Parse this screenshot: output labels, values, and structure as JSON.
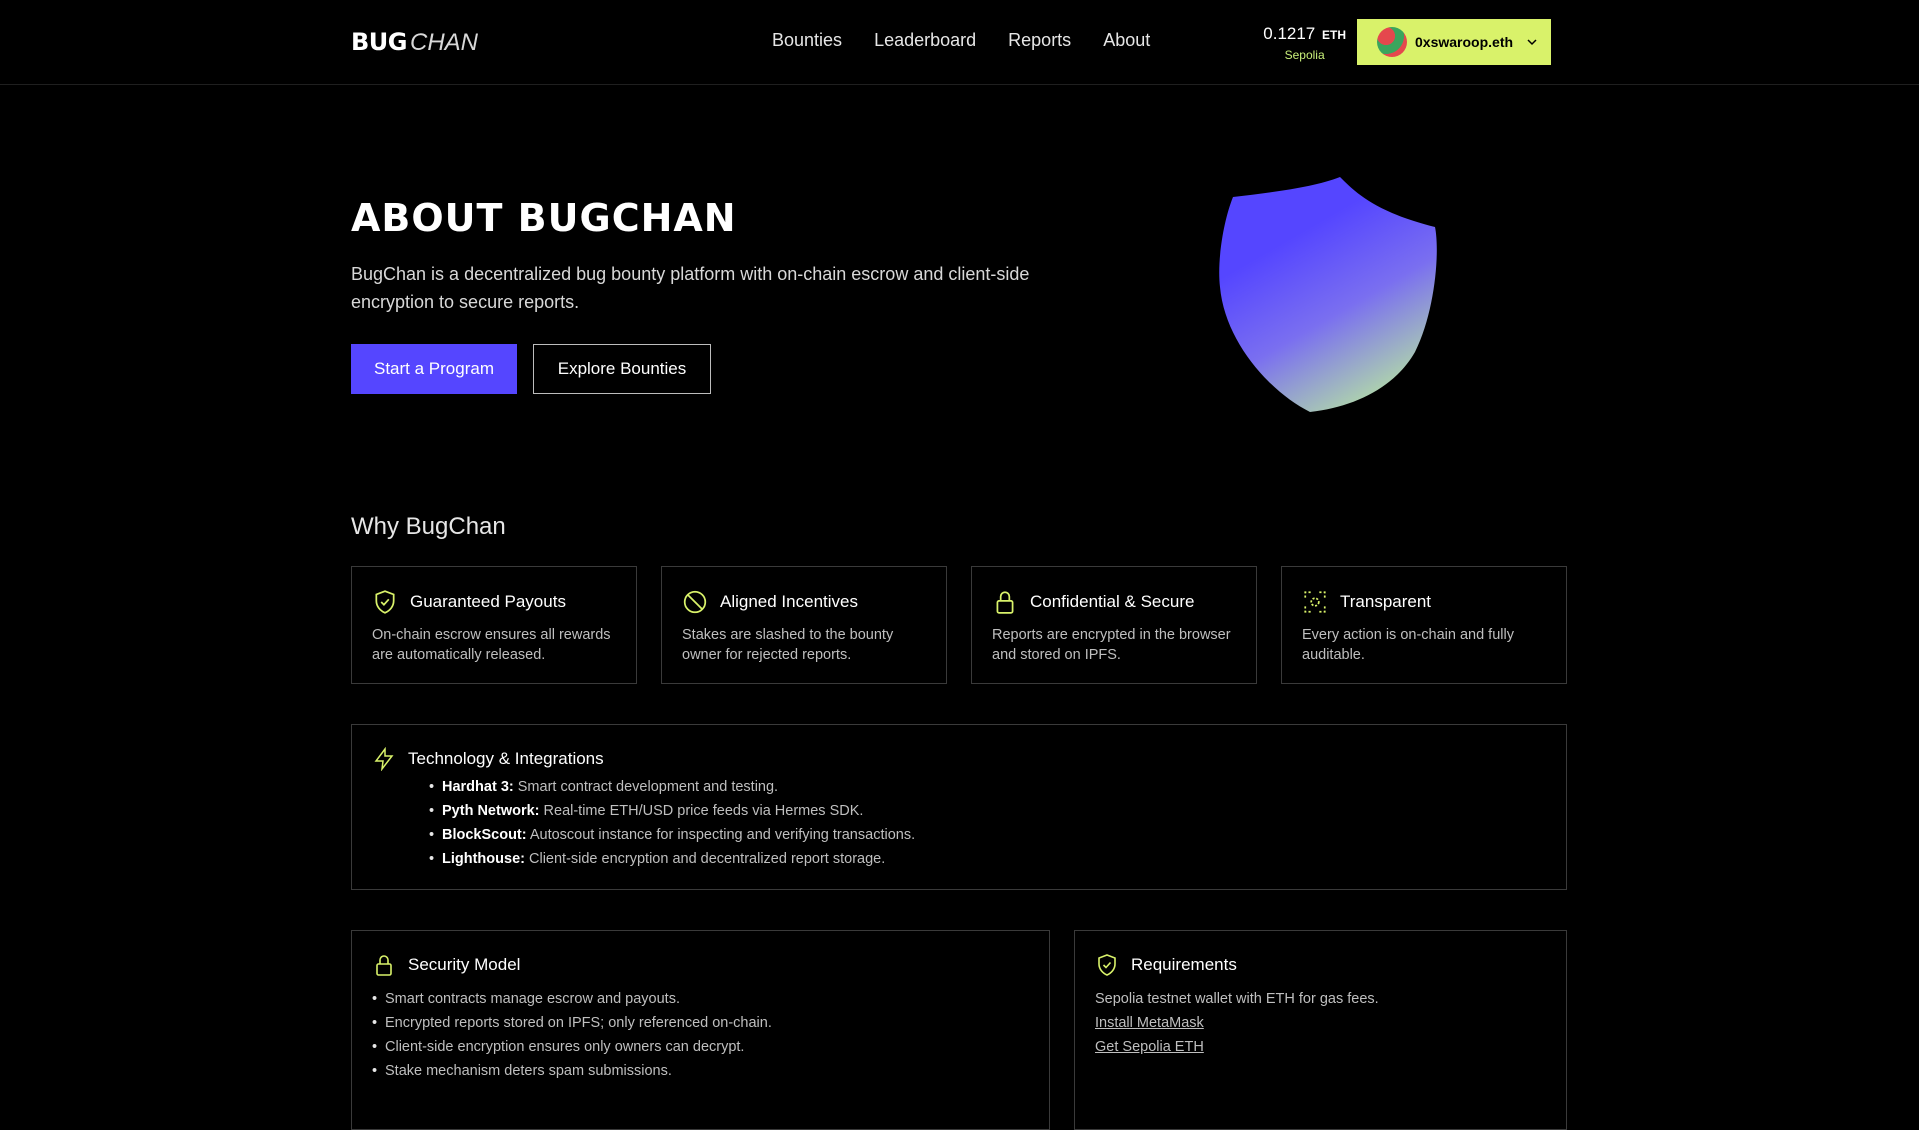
{
  "header": {
    "logo_bold": "BUG",
    "logo_light": "CHAN",
    "nav": [
      "Bounties",
      "Leaderboard",
      "Reports",
      "About"
    ],
    "balance_amount": "0.1217",
    "balance_unit": "ETH",
    "network": "Sepolia",
    "wallet_name": "0xswaroop.eth"
  },
  "hero": {
    "title": "ABOUT BUGCHAN",
    "description": "BugChan is a decentralized bug bounty platform with on-chain escrow and client-side encryption to secure reports.",
    "primary_button": "Start a Program",
    "secondary_button": "Explore Bounties"
  },
  "why": {
    "title": "Why BugChan",
    "features": [
      {
        "icon": "shield-check-icon",
        "title": "Guaranteed Payouts",
        "desc": "On-chain escrow ensures all rewards are automatically released."
      },
      {
        "icon": "slash-circle-icon",
        "title": "Aligned Incentives",
        "desc": "Stakes are slashed to the bounty owner for rejected reports."
      },
      {
        "icon": "lock-icon",
        "title": "Confidential & Secure",
        "desc": "Reports are encrypted in the browser and stored on IPFS."
      },
      {
        "icon": "focus-icon",
        "title": "Transparent",
        "desc": "Every action is on-chain and fully auditable."
      }
    ]
  },
  "tech": {
    "title": "Technology & Integrations",
    "items": [
      {
        "name": "Hardhat 3:",
        "text": "Smart contract development and testing."
      },
      {
        "name": "Pyth Network:",
        "text": "Real-time ETH/USD price feeds via Hermes SDK."
      },
      {
        "name": "BlockScout:",
        "text": "Autoscout instance for inspecting and verifying transactions."
      },
      {
        "name": "Lighthouse:",
        "text": "Client-side encryption and decentralized report storage."
      }
    ]
  },
  "security": {
    "title": "Security Model",
    "items": [
      "Smart contracts manage escrow and payouts.",
      "Encrypted reports stored on IPFS; only referenced on-chain.",
      "Client-side encryption ensures only owners can decrypt.",
      "Stake mechanism deters spam submissions."
    ]
  },
  "requirements": {
    "title": "Requirements",
    "text": "Sepolia testnet wallet with ETH for gas fees.",
    "links": [
      "Install MetaMask",
      "Get Sepolia ETH"
    ]
  },
  "colors": {
    "accent": "#5546ff",
    "wallet_bg": "#d9f26a",
    "network_text": "#c9f07a"
  }
}
